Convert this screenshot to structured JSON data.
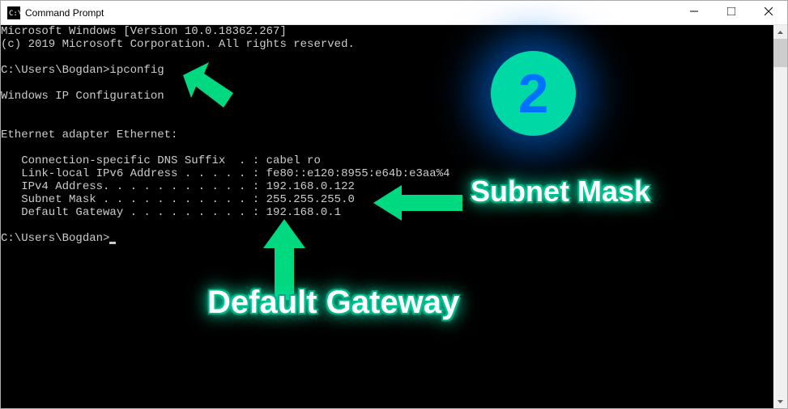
{
  "window": {
    "title": "Command Prompt",
    "minimize": "—",
    "maximize": "☐",
    "close": "✕"
  },
  "console": {
    "line1": "Microsoft Windows [Version 10.0.18362.267]",
    "line2": "(c) 2019 Microsoft Corporation. All rights reserved.",
    "blank": "",
    "prompt1_path": "C:\\Users\\Bogdan>",
    "prompt1_cmd": "ipconfig",
    "heading1": "Windows IP Configuration",
    "adapter": "Ethernet adapter Ethernet:",
    "dns_suffix_line": "   Connection-specific DNS Suffix  . : cabel ro",
    "ipv6_line": "   Link-local IPv6 Address . . . . . : fe80::e120:8955:e64b:e3aa%4",
    "ipv4_line": "   IPv4 Address. . . . . . . . . . . : 192.168.0.122",
    "subnet_line": "   Subnet Mask . . . . . . . . . . . : 255.255.255.0",
    "gateway_line": "   Default Gateway . . . . . . . . . : 192.168.0.1",
    "prompt2_path": "C:\\Users\\Bogdan>"
  },
  "annotations": {
    "step_number": "2",
    "subnet_label": "Subnet Mask",
    "gateway_label": "Default Gateway"
  }
}
